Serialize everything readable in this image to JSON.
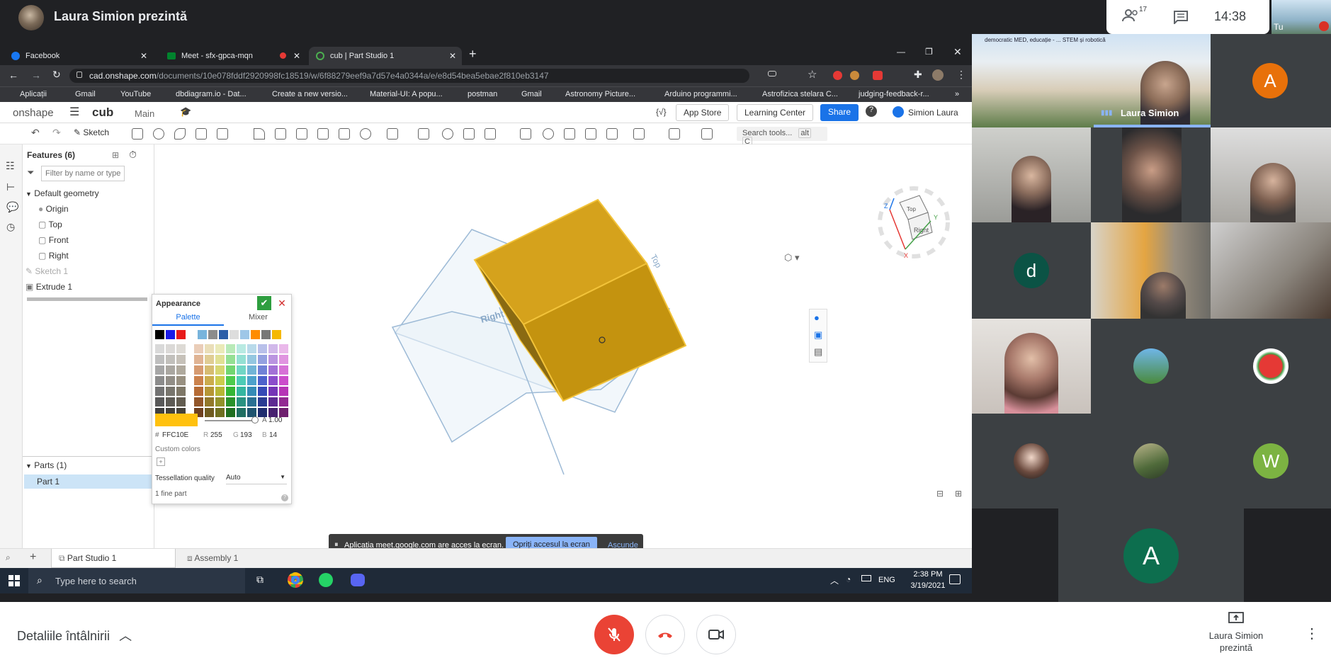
{
  "meet": {
    "presenter_name": "Laura Simion prezintă",
    "participant_count": "17",
    "time": "14:38",
    "self_label": "Tu",
    "details_label": "Detaliile întâlnirii",
    "present_label": "Laura Simion prezintă",
    "main_tile_label": "Laura Simion",
    "main_tile_banner": "democratic MED, educație - ... STEM și robotică",
    "avatars": [
      {
        "letter": "A",
        "color": "#e8710a"
      },
      {
        "letter": "d",
        "color": "#0b5345"
      },
      {
        "letter": "W",
        "color": "#7cb342"
      },
      {
        "letter": "A",
        "color": "#0d6e4e"
      }
    ]
  },
  "browser": {
    "tabs": [
      {
        "label": "Facebook",
        "icon": "facebook-icon"
      },
      {
        "label": "Meet - sfx-gpca-mqn",
        "icon": "meet-icon"
      },
      {
        "label": "cub | Part Studio 1",
        "icon": "onshape-icon"
      }
    ],
    "url_host": "cad.onshape.com",
    "url_path": "/documents/10e078fddf2920998fc18519/w/6f88279eef9a7d57e4a0344a/e/e8d54bea5ebae2f810eb3147",
    "bookmarks": [
      "Aplicații",
      "Gmail",
      "YouTube",
      "dbdiagram.io - Dat...",
      "Create a new versio...",
      "Material-UI: A popu...",
      "postman",
      "Gmail",
      "Astronomy Picture...",
      "Arduino programmi...",
      "Astrofizica stelara C...",
      "judging-feedback-r..."
    ],
    "more": "»"
  },
  "onshape": {
    "logo": "onshape",
    "doc_name": "cub",
    "branch": "Main",
    "app_store": "App Store",
    "learning_center": "Learning Center",
    "share": "Share",
    "user": "Simion Laura",
    "sketch": "Sketch",
    "search_tools": "Search tools...",
    "search_shortcut_1": "alt",
    "search_shortcut_2": "C",
    "features_title": "Features (6)",
    "filter_placeholder": "Filter by name or type",
    "default_geometry": "Default geometry",
    "origin": "Origin",
    "top": "Top",
    "front": "Front",
    "right": "Right",
    "sketch1": "Sketch 1",
    "extrude1": "Extrude 1",
    "parts_title": "Parts (1)",
    "part1": "Part 1",
    "plane_top": "Top",
    "plane_right": "Right",
    "viewcube_top": "Top",
    "viewcube_right": "Right",
    "axis_x": "X",
    "axis_y": "Y",
    "axis_z": "Z",
    "tab_part_studio": "Part Studio 1",
    "tab_assembly": "Assembly 1"
  },
  "appearance": {
    "title": "Appearance",
    "tab_palette": "Palette",
    "tab_mixer": "Mixer",
    "alpha_label": "A",
    "alpha_value": "1.00",
    "hex_label": "#",
    "hex": "FFC10E",
    "r_label": "R",
    "r": "255",
    "g_label": "G",
    "g": "193",
    "b_label": "B",
    "b": "14",
    "custom_colors": "Custom colors",
    "tessellation_label": "Tessellation quality",
    "tessellation_value": "Auto",
    "footer": "1 fine part",
    "swatch_color": "#FFC10E"
  },
  "share_notice": {
    "text": "Aplicația meet.google.com are acces la ecran.",
    "stop": "Opriți accesul la ecran",
    "hide": "Ascunde"
  },
  "taskbar": {
    "search_placeholder": "Type here to search",
    "lang": "ENG",
    "time": "2:38 PM",
    "date": "3/19/2021"
  }
}
